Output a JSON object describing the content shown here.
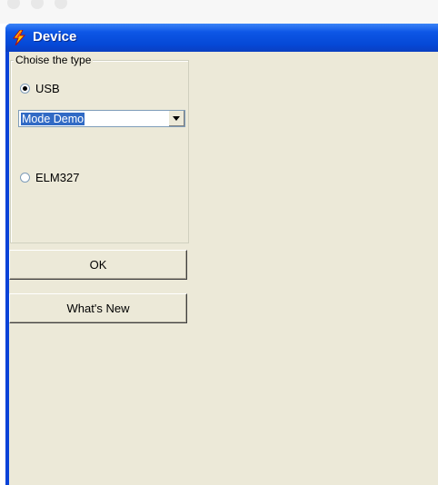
{
  "window": {
    "title": "Device"
  },
  "group": {
    "legend": "Choise the type",
    "options": [
      {
        "label": "USB",
        "checked": true
      },
      {
        "label": "ELM327",
        "checked": false
      }
    ],
    "mode_select": {
      "value": "Mode Demo"
    }
  },
  "buttons": {
    "ok": "OK",
    "whats_new": "What's New"
  },
  "colors": {
    "titlebar": "#0548d6",
    "client": "#ece9d8",
    "selection": "#316ac5"
  }
}
